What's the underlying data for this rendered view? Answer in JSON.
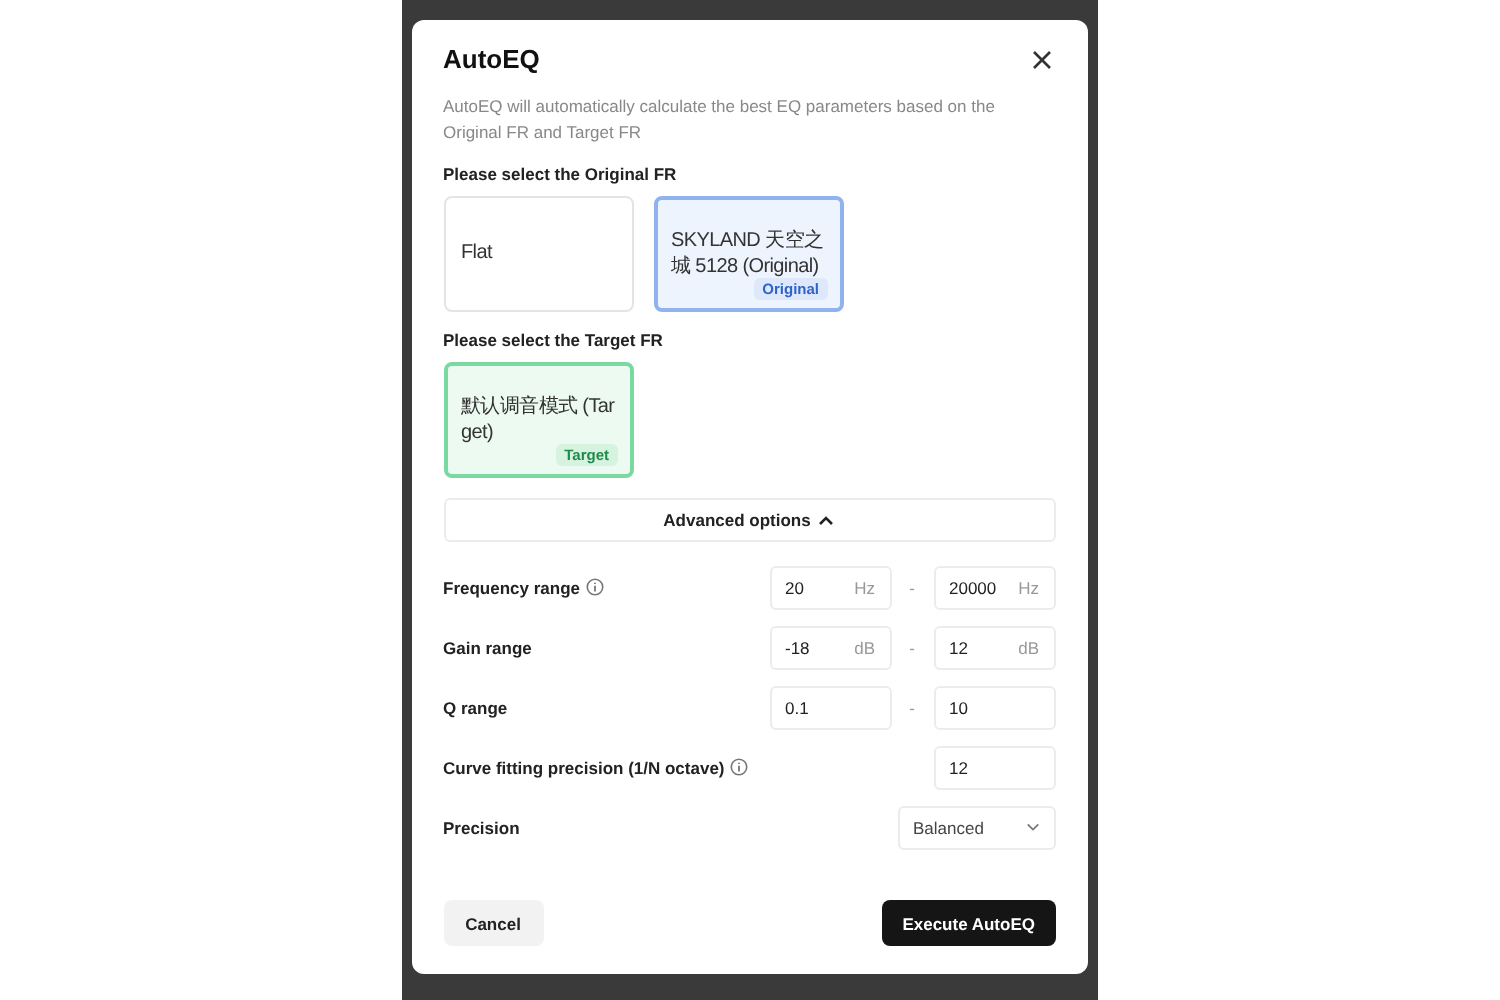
{
  "dialog": {
    "title": "AutoEQ",
    "description": "AutoEQ will automatically calculate the best EQ parameters based on the Original FR and Target FR",
    "sections": [
      {
        "kind": "original",
        "heading": "Please select the Original FR",
        "options": [
          {
            "label": "Flat",
            "selected": false
          },
          {
            "label": "SKYLAND 天空之城 5128 (Original)",
            "selected": true,
            "badge": "Original"
          }
        ]
      },
      {
        "kind": "target",
        "heading": "Please select the Target FR",
        "options": [
          {
            "label": "默认调音模式 (Target)",
            "selected": true,
            "badge": "Target"
          }
        ]
      }
    ],
    "advanced": {
      "label": "Advanced options",
      "expanded": true
    },
    "settings": [
      {
        "kind": "range",
        "label": "Frequency range",
        "info": true,
        "min": {
          "value": "20",
          "unit": "Hz"
        },
        "separator": "-",
        "max": {
          "value": "20000",
          "unit": "Hz"
        }
      },
      {
        "kind": "range",
        "label": "Gain range",
        "info": false,
        "min": {
          "value": "-18",
          "unit": "dB"
        },
        "separator": "-",
        "max": {
          "value": "12",
          "unit": "dB"
        }
      },
      {
        "kind": "range",
        "label": "Q range",
        "info": false,
        "min": {
          "value": "0.1"
        },
        "separator": "-",
        "max": {
          "value": "10"
        }
      },
      {
        "kind": "single",
        "label": "Curve fitting precision (1/N octave)",
        "info": true,
        "value": "12"
      },
      {
        "kind": "select",
        "label": "Precision",
        "info": false,
        "value": "Balanced"
      }
    ],
    "buttons": [
      {
        "kind": "secondary",
        "label": "Cancel"
      },
      {
        "kind": "primary",
        "label": "Execute AutoEQ"
      }
    ]
  }
}
